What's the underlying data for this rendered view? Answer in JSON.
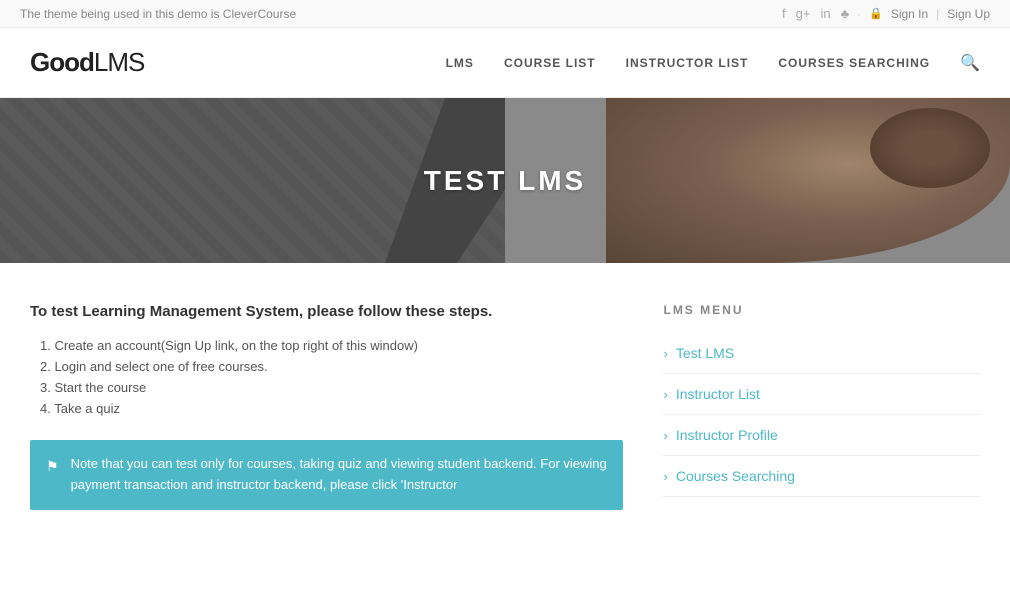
{
  "topbar": {
    "theme_note": "The theme being used in this demo is CleverCourse",
    "social_icons": [
      "f",
      "g+",
      "in",
      "♡"
    ],
    "dot": "·",
    "lock_symbol": "🔒",
    "sign_in": "Sign In",
    "separator": "|",
    "sign_up": "Sign Up"
  },
  "header": {
    "logo_bold": "Good",
    "logo_light": "LMS",
    "nav_items": [
      {
        "label": "LMS",
        "id": "nav-lms"
      },
      {
        "label": "COURSE LIST",
        "id": "nav-course-list"
      },
      {
        "label": "INSTRUCTOR LIST",
        "id": "nav-instructor-list"
      },
      {
        "label": "COURSES SEARCHING",
        "id": "nav-courses-searching"
      }
    ],
    "search_label": "Search"
  },
  "hero": {
    "title": "TEST LMS"
  },
  "main": {
    "intro": "To test Learning Management System, please follow these steps.",
    "steps": [
      "1. Create an account(Sign Up link, on the top right of this window)",
      "2. Login and select one of free courses.",
      "3. Start the course",
      "4. Take a quiz"
    ],
    "note": "Note that you can test only for courses, taking quiz and viewing student backend. For viewing payment transaction and instructor backend, please click 'Instructor"
  },
  "sidebar": {
    "title": "LMS MENU",
    "items": [
      {
        "label": "Test LMS"
      },
      {
        "label": "Instructor List"
      },
      {
        "label": "Instructor Profile"
      },
      {
        "label": "Courses Searching"
      }
    ]
  }
}
